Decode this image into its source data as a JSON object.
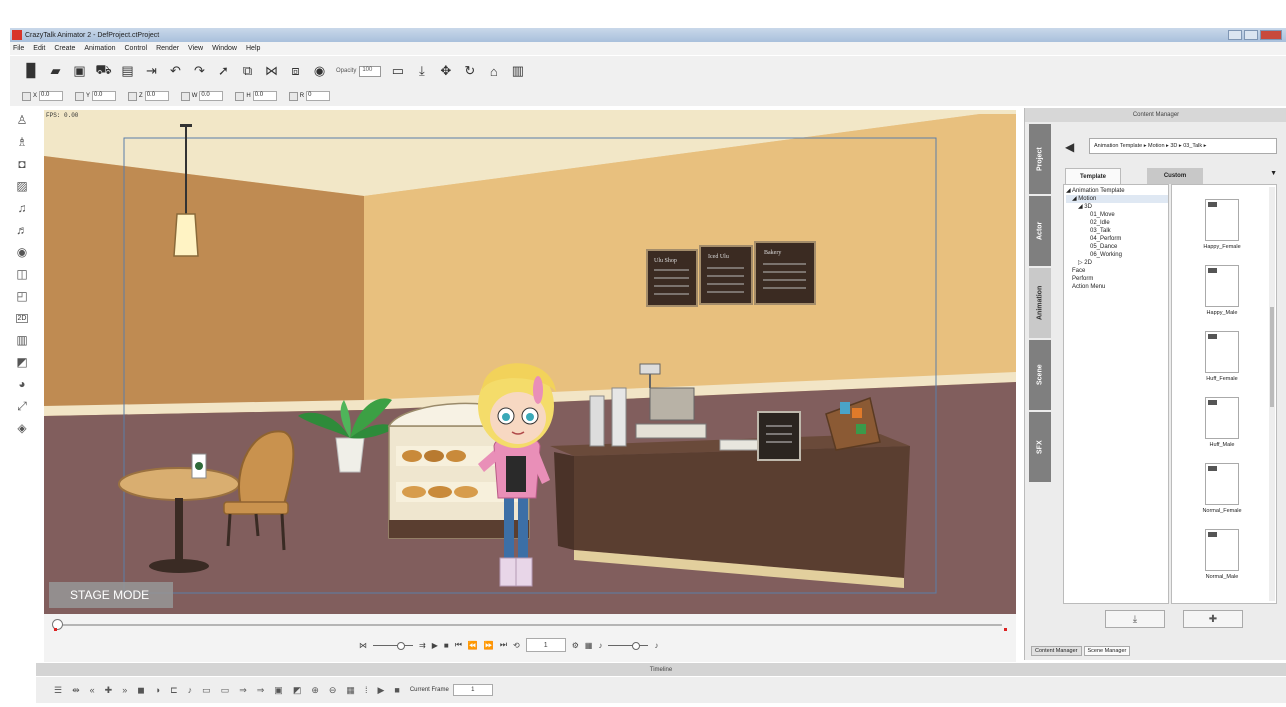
{
  "window": {
    "title": "CrazyTalk Animator 2 - DefProject.ctProject"
  },
  "menu": [
    "File",
    "Edit",
    "Create",
    "Animation",
    "Control",
    "Render",
    "View",
    "Window",
    "Help"
  ],
  "toolbar": {
    "opacity_label": "Opacity",
    "opacity_value": "100"
  },
  "transform": [
    {
      "label": "X",
      "value": "0.0"
    },
    {
      "label": "Y",
      "value": "0.0"
    },
    {
      "label": "Z",
      "value": "0.0"
    },
    {
      "label": "W",
      "value": "0.0"
    },
    {
      "label": "H",
      "value": "0.0"
    },
    {
      "label": "R",
      "value": "0"
    }
  ],
  "stage": {
    "fps": "FPS: 0.00",
    "mode_label": "STAGE MODE"
  },
  "menuboard": [
    "Ulu Shop",
    "Iced Ulu",
    "Bakery"
  ],
  "playback": {
    "frame": "1"
  },
  "timeline": {
    "title": "Timeline",
    "current_frame_label": "Current Frame",
    "current_frame": "1"
  },
  "content_manager": {
    "title": "Content Manager",
    "side_tabs": [
      "Project",
      "Actor",
      "Animation",
      "Scene",
      "SFX"
    ],
    "breadcrumb": "Animation Template ▸ Motion ▸ 3D ▸ 03_Talk ▸",
    "tabs": [
      "Template",
      "Custom"
    ],
    "tree": [
      "◢ Animation Template",
      "◢ Motion",
      "◢ 3D",
      "01_Move",
      "02_Idle",
      "03_Talk",
      "04_Perform",
      "05_Dance",
      "06_Working",
      "▷ 2D",
      "Face",
      "Perform",
      "Action Menu"
    ],
    "thumbs": [
      "Happy_Female",
      "Happy_Male",
      "Huff_Female",
      "Huff_Male",
      "Normal_Female",
      "Normal_Male"
    ],
    "footer_tabs": [
      "Content Manager",
      "Scene Manager"
    ]
  },
  "colors": {
    "ceiling": "#f2e7c7",
    "wall_left": "#bf8b52",
    "wall_right": "#e8c07e",
    "floor": "#815e5d",
    "counter": "#5a3e30"
  }
}
